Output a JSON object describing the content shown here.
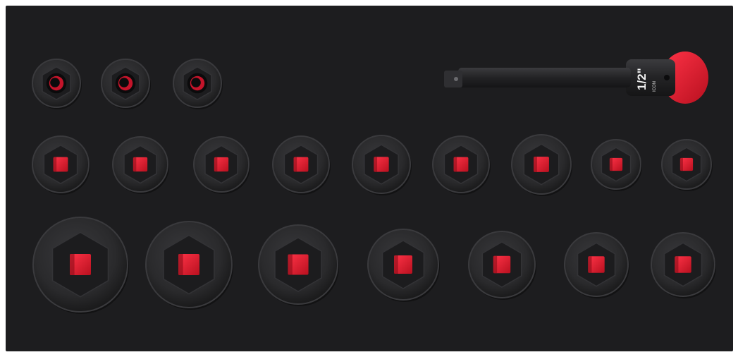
{
  "colors": {
    "background": "#ffffff",
    "tray": "#1d1d1f",
    "socket": "#2a2a2c",
    "socket_rim": "#3a3a3d",
    "socket_shadow": "#141415",
    "accent_red": "#e0162b",
    "bore": "#0b0b0c"
  },
  "extension_bar": {
    "size_label": "1/2\"",
    "brand_label": "ICON"
  },
  "rows": [
    {
      "name": "small-deep-sockets",
      "socket_count": 3,
      "insert": "round-red"
    },
    {
      "name": "medium-sockets",
      "socket_count": 9,
      "insert": "square-red"
    },
    {
      "name": "large-sockets",
      "socket_count": 7,
      "insert": "square-red"
    }
  ]
}
